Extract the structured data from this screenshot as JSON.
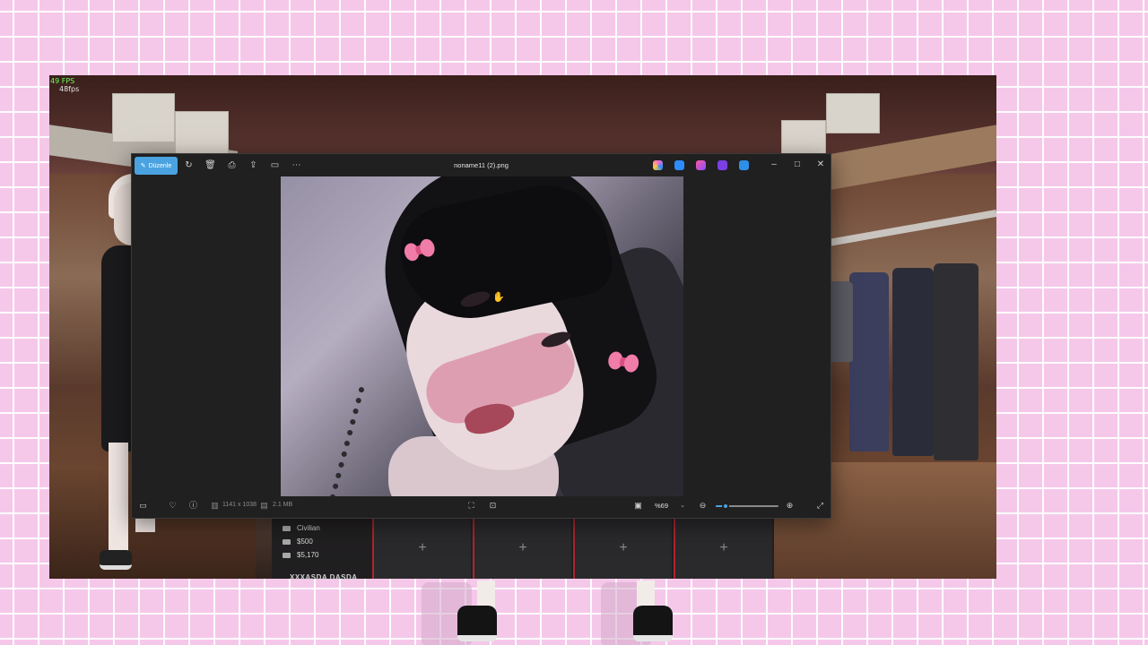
{
  "overlay": {
    "fps_game": "49 FPS",
    "fps_capture": "48fps"
  },
  "viewer": {
    "title": "noname11 (2).png",
    "edit_label": "Düzenle",
    "toolbar_icons": [
      "rotate-icon",
      "delete-icon",
      "print-icon",
      "share-icon",
      "slideshow-icon",
      "more-icon"
    ],
    "app_icons": [
      {
        "name": "copilot-icon",
        "color": "#ff6ec7"
      },
      {
        "name": "designer-icon",
        "color": "#2f8cff"
      },
      {
        "name": "clipchamp-icon",
        "color": "#8a4cff"
      },
      {
        "name": "paint-icon",
        "color": "#7b3fe4"
      },
      {
        "name": "onedrive-icon",
        "color": "#2e8fe6"
      }
    ],
    "status": {
      "dimensions": "1141 x 1038",
      "file_size": "2.1 MB",
      "zoom": "%69",
      "zoom_level": 0.15
    }
  },
  "hud": {
    "job": "Civilian",
    "cash": "$500",
    "bank": "$5,170",
    "player_name": "XXXASDA DASDA",
    "slot_symbol": "+"
  }
}
